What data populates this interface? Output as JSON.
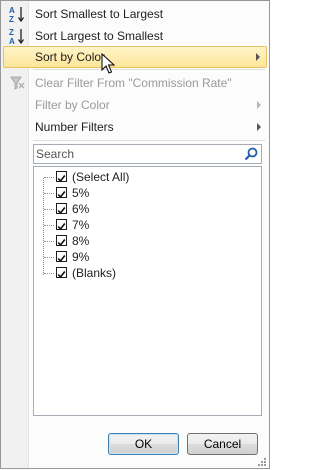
{
  "menu": {
    "sort_asc": {
      "label": "Sort Smallest to Largest",
      "icon": "sort-ascending-icon"
    },
    "sort_desc": {
      "label": "Sort Largest to Smallest",
      "icon": "sort-descending-icon"
    },
    "sort_by_color": {
      "label": "Sort by Color",
      "state": "hovered"
    },
    "clear_filter": {
      "label": "Clear Filter From \"Commission Rate\"",
      "icon": "clear-filter-icon",
      "state": "disabled"
    },
    "filter_by_color": {
      "label": "Filter by Color",
      "state": "disabled"
    },
    "number_filters": {
      "label": "Number Filters"
    }
  },
  "search": {
    "placeholder": "Search",
    "icon": "magnifier-icon"
  },
  "values": [
    {
      "label": "(Select All)",
      "checked": true
    },
    {
      "label": "5%",
      "checked": true
    },
    {
      "label": "6%",
      "checked": true
    },
    {
      "label": "7%",
      "checked": true
    },
    {
      "label": "8%",
      "checked": true
    },
    {
      "label": "9%",
      "checked": true
    },
    {
      "label": "(Blanks)",
      "checked": true
    }
  ],
  "buttons": {
    "ok": "OK",
    "cancel": "Cancel"
  },
  "colors": {
    "hover_fill": "#fde69a",
    "hover_border": "#e6c25e",
    "disabled_text": "#9a9a9a",
    "accent_blue": "#1f5fa8"
  }
}
